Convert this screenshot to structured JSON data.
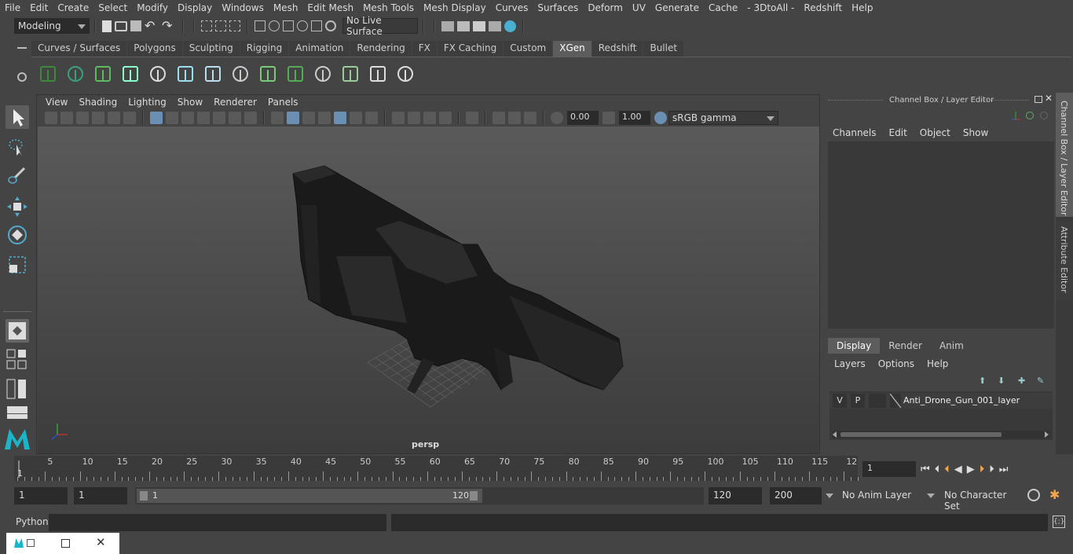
{
  "menubar": {
    "items": [
      "File",
      "Edit",
      "Create",
      "Select",
      "Modify",
      "Display",
      "Windows",
      "Mesh",
      "Edit Mesh",
      "Mesh Tools",
      "Mesh Display",
      "Curves",
      "Surfaces",
      "Deform",
      "UV",
      "Generate",
      "Cache",
      "- 3DtoAll -",
      "Redshift",
      "Help"
    ]
  },
  "statusline": {
    "mode": "Modeling",
    "live_surface": "No Live Surface"
  },
  "shelf": {
    "tabs": [
      "Curves / Surfaces",
      "Polygons",
      "Sculpting",
      "Rigging",
      "Animation",
      "Rendering",
      "FX",
      "FX Caching",
      "Custom",
      "XGen",
      "Redshift",
      "Bullet"
    ],
    "active_tab": "XGen",
    "icons": [
      "xgen-create-description-icon",
      "xgen-toggle-preview-icon",
      "xgen-leaf-icon",
      "xgen-add-guides-icon",
      "xgen-move-guides-icon",
      "xgen-add-guide-icon",
      "xgen-select-guide-icon",
      "xgen-lock-guide-icon",
      "xgen-sculpt-guides-icon",
      "xgen-grid-icon",
      "xgen-scale-guides-icon",
      "xgen-comb-icon",
      "xgen-cut-icon",
      "xgen-cross-icon"
    ]
  },
  "viewport": {
    "menu": [
      "View",
      "Shading",
      "Lighting",
      "Show",
      "Renderer",
      "Panels"
    ],
    "exposure": "0.00",
    "gamma": "1.00",
    "color_space": "sRGB gamma",
    "camera_label": "persp"
  },
  "channelbox": {
    "title": "Channel Box / Layer Editor",
    "menu": [
      "Channels",
      "Edit",
      "Object",
      "Show"
    ],
    "layer_tabs": [
      "Display",
      "Render",
      "Anim"
    ],
    "active_layer_tab": "Display",
    "layer_menu": [
      "Layers",
      "Options",
      "Help"
    ],
    "layers": [
      {
        "v": "V",
        "p": "P",
        "name": "Anti_Drone_Gun_001_layer"
      }
    ]
  },
  "sidetabs": [
    "Channel Box / Layer Editor",
    "Attribute Editor"
  ],
  "timeline": {
    "ticks": [
      "5",
      "10",
      "15",
      "20",
      "25",
      "30",
      "35",
      "40",
      "45",
      "50",
      "55",
      "60",
      "65",
      "70",
      "75",
      "80",
      "85",
      "90",
      "95",
      "100",
      "105",
      "110",
      "115",
      "12"
    ],
    "start_marker": "1",
    "current_frame": "1"
  },
  "range": {
    "start": "1",
    "playback_start": "1",
    "slider_start": "1",
    "slider_end": "120",
    "playback_end": "120",
    "end": "200",
    "anim_layer": "No Anim Layer",
    "character_set": "No Character Set"
  },
  "cmdline": {
    "label": "Python"
  }
}
